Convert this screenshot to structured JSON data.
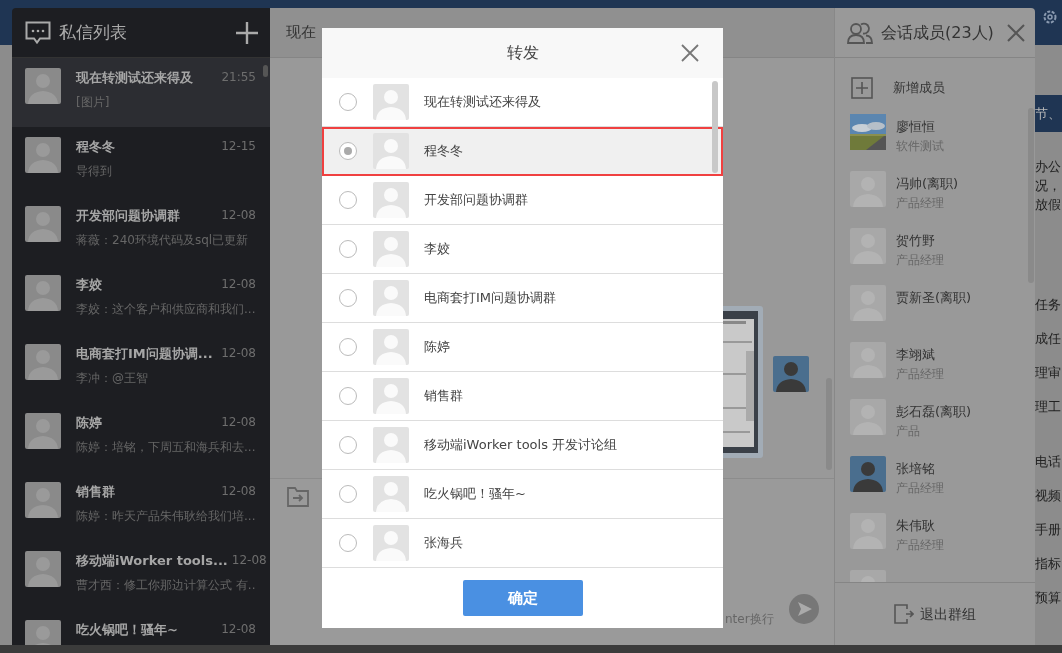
{
  "background": {
    "fragments": [
      "节、",
      "办公",
      "况，",
      "放假",
      "任务",
      "成任",
      "理审",
      "理工",
      "电话",
      "视频",
      "手册",
      "指标",
      "预算"
    ]
  },
  "sidebar": {
    "title": "私信列表",
    "items": [
      {
        "name": "现在转测试还来得及",
        "time": "21:55",
        "preview": "[图片]",
        "selected": true
      },
      {
        "name": "程冬冬",
        "time": "12-15",
        "preview": "导得到",
        "selected": false
      },
      {
        "name": "开发部问题协调群",
        "time": "12-08",
        "preview": "蒋薇：240环境代码及sql已更新",
        "selected": false
      },
      {
        "name": "李姣",
        "time": "12-08",
        "preview": "李姣：这个客户和供应商和我们...",
        "selected": false
      },
      {
        "name": "电商套打IM问题协调...",
        "time": "12-08",
        "preview": "李冲：@王智",
        "selected": false
      },
      {
        "name": "陈婷",
        "time": "12-08",
        "preview": "陈婷：培铭，下周五和海兵和去...",
        "selected": false
      },
      {
        "name": "销售群",
        "time": "12-08",
        "preview": "陈婷：昨天产品朱伟耿给我们培...",
        "selected": false
      },
      {
        "name": "移动端iWorker tools...",
        "time": "12-08",
        "preview": "曹才西：修工你那边计算公式 有..",
        "selected": false
      },
      {
        "name": "吃火锅吧！骚年~",
        "time": "12-08",
        "selected": false
      }
    ]
  },
  "chat": {
    "title": "现在",
    "input_hint": "nter换行"
  },
  "members": {
    "title": "会话成员(23人)",
    "add_label": "新增成员",
    "items": [
      {
        "name": "廖恒恒",
        "role": "软件测试"
      },
      {
        "name": "冯帅(离职)",
        "role": "产品经理",
        "kind": "default"
      },
      {
        "name": "贺竹野",
        "role": "产品经理",
        "kind": "default"
      },
      {
        "name": "贾新圣(离职)",
        "kind": "default"
      },
      {
        "name": "李翊斌",
        "role": "产品经理",
        "kind": "default"
      },
      {
        "name": "彭石磊(离职)",
        "role": "产品",
        "kind": "default"
      },
      {
        "name": "张培铭",
        "role": "产品经理",
        "kind": "figure"
      },
      {
        "name": "朱伟耿",
        "role": "产品经理",
        "kind": "default"
      },
      {
        "kind": "default"
      }
    ],
    "leave_label": "退出群组"
  },
  "dialog": {
    "title": "转发",
    "items": [
      {
        "name": "现在转测试还来得及",
        "selected": false
      },
      {
        "name": "程冬冬",
        "selected": true
      },
      {
        "name": "开发部问题协调群",
        "selected": false
      },
      {
        "name": "李姣",
        "selected": false
      },
      {
        "name": "电商套打IM问题协调群",
        "selected": false
      },
      {
        "name": "陈婷",
        "selected": false
      },
      {
        "name": "销售群",
        "selected": false
      },
      {
        "name": "移动端iWorker tools 开发讨论组",
        "selected": false
      },
      {
        "name": "吃火锅吧！骚年~",
        "selected": false
      },
      {
        "name": "张海兵",
        "selected": false
      }
    ],
    "confirm": "确定"
  }
}
